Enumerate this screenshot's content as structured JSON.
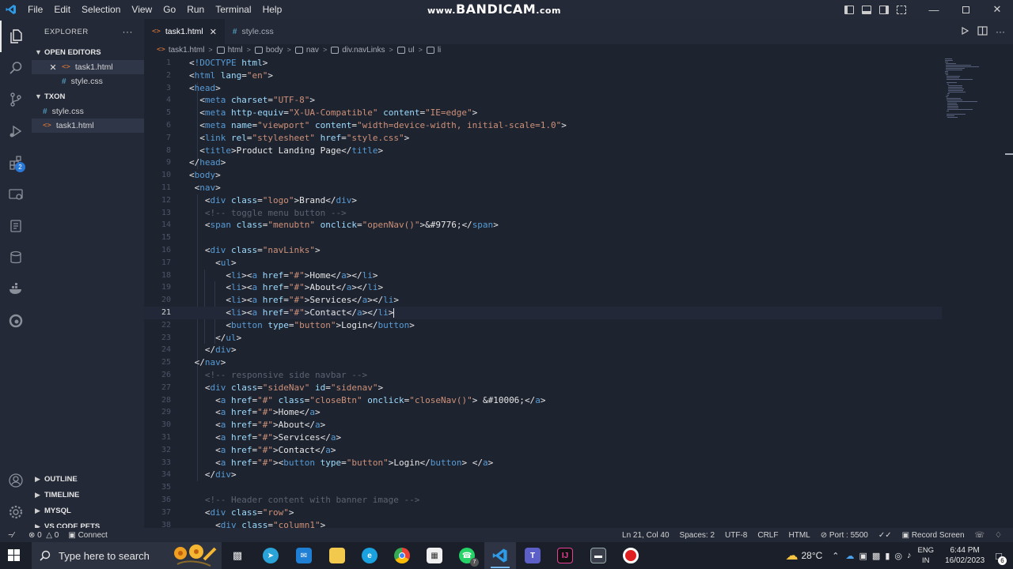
{
  "titlebar": {
    "menu": [
      "File",
      "Edit",
      "Selection",
      "View",
      "Go",
      "Run",
      "Terminal",
      "Help"
    ],
    "watermark_prefix": "www.",
    "watermark": "BANDICAM",
    "watermark_suffix": ".com"
  },
  "sidebar": {
    "title": "EXPLORER",
    "more": "···",
    "open_editors": "OPEN EDITORS",
    "open_files": [
      "task1.html",
      "style.css"
    ],
    "folder": "TXON",
    "folder_files": [
      "style.css",
      "task1.html"
    ],
    "outline": "OUTLINE",
    "timeline": "TIMELINE",
    "mysql": "MYSQL",
    "vscode_pets": "VS CODE PETS",
    "extensions_badge": "2"
  },
  "tabs": [
    {
      "label": "task1.html",
      "active": true
    },
    {
      "label": "style.css",
      "active": false
    }
  ],
  "breadcrumb": [
    "task1.html",
    "html",
    "body",
    "nav",
    "div.navLinks",
    "ul",
    "li"
  ],
  "editor": {
    "current_line": 21,
    "lines": [
      {
        "n": "1",
        "t": "<!DOCTYPE html>"
      },
      {
        "n": "2",
        "t": "<html lang=\"en\">"
      },
      {
        "n": "3",
        "t": "<head>"
      },
      {
        "n": "4",
        "t": "  <meta charset=\"UTF-8\">"
      },
      {
        "n": "5",
        "t": "  <meta http-equiv=\"X-UA-Compatible\" content=\"IE=edge\">"
      },
      {
        "n": "6",
        "t": "  <meta name=\"viewport\" content=\"width=device-width, initial-scale=1.0\">"
      },
      {
        "n": "7",
        "t": "  <link rel=\"stylesheet\" href=\"style.css\">"
      },
      {
        "n": "8",
        "t": "  <title>Product Landing Page</title>"
      },
      {
        "n": "9",
        "t": "</head>"
      },
      {
        "n": "10",
        "t": "<body>"
      },
      {
        "n": "11",
        "t": " <nav>"
      },
      {
        "n": "12",
        "t": "   <div class=\"logo\">Brand</div>"
      },
      {
        "n": "13",
        "t": "   <!-- toggle menu button -->"
      },
      {
        "n": "14",
        "t": "   <span class=\"menubtn\" onclick=\"openNav()\">&#9776;</span>"
      },
      {
        "n": "15",
        "t": ""
      },
      {
        "n": "16",
        "t": "   <div class=\"navLinks\">"
      },
      {
        "n": "17",
        "t": "     <ul>"
      },
      {
        "n": "18",
        "t": "       <li><a href=\"#\">Home</a></li>"
      },
      {
        "n": "19",
        "t": "       <li><a href=\"#\">About</a></li>"
      },
      {
        "n": "20",
        "t": "       <li><a href=\"#\">Services</a></li>"
      },
      {
        "n": "21",
        "t": "       <li><a href=\"#\">Contact</a></li>"
      },
      {
        "n": "22",
        "t": "       <button type=\"button\">Login</button>"
      },
      {
        "n": "23",
        "t": "     </ul>"
      },
      {
        "n": "24",
        "t": "   </div>"
      },
      {
        "n": "25",
        "t": " </nav>"
      },
      {
        "n": "26",
        "t": "   <!-- responsive side navbar -->"
      },
      {
        "n": "27",
        "t": "   <div class=\"sideNav\" id=\"sidenav\">"
      },
      {
        "n": "28",
        "t": "     <a href=\"#\" class=\"closeBtn\" onclick=\"closeNav()\"> &#10006;</a>"
      },
      {
        "n": "29",
        "t": "     <a href=\"#\">Home</a>"
      },
      {
        "n": "30",
        "t": "     <a href=\"#\">About</a>"
      },
      {
        "n": "31",
        "t": "     <a href=\"#\">Services</a>"
      },
      {
        "n": "32",
        "t": "     <a href=\"#\">Contact</a>"
      },
      {
        "n": "33",
        "t": "     <a href=\"#\"><button type=\"button\">Login</button> </a>"
      },
      {
        "n": "34",
        "t": "   </div>"
      },
      {
        "n": "35",
        "t": ""
      },
      {
        "n": "36",
        "t": "   <!-- Header content with banner image -->"
      },
      {
        "n": "37",
        "t": "   <div class=\"row\">"
      },
      {
        "n": "38",
        "t": "     <div class=\"column1\">"
      }
    ]
  },
  "statusbar": {
    "problems": "0",
    "warnings": "0",
    "connect": "Connect",
    "position": "Ln 21, Col 40",
    "spaces": "Spaces: 2",
    "encoding": "UTF-8",
    "eol": "CRLF",
    "language": "HTML",
    "port": "Port : 5500",
    "record": "Record Screen"
  },
  "taskbar": {
    "search_placeholder": "Type here to search",
    "temperature": "28°C",
    "lang1": "ENG",
    "lang2": "IN",
    "time": "6:44 PM",
    "date": "16/02/2023",
    "whatsapp_badge": "7",
    "notification_count": "6"
  },
  "colors": {
    "tag": "#569cd6",
    "attr": "#9cdcfe",
    "string": "#ce9178",
    "comment": "#5c6370",
    "text": "#e6e6e6",
    "html_icon": "#e37933",
    "css_icon": "#519aba"
  }
}
